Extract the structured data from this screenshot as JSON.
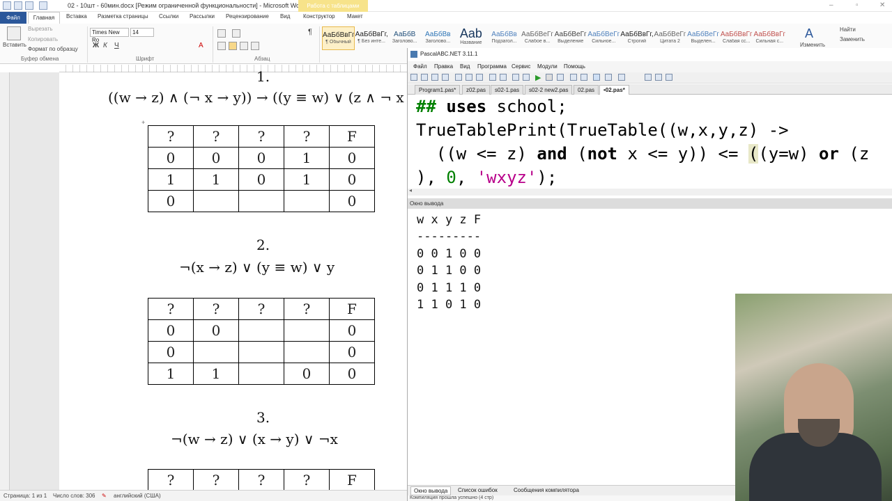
{
  "word": {
    "title": "02 - 10шт - 60мин.docx [Режим ограниченной функциональности] - Microsoft Word",
    "context_tab": "Работа с таблицами",
    "tabs": [
      "Файл",
      "Главная",
      "Вставка",
      "Разметка страницы",
      "Ссылки",
      "Рассылки",
      "Рецензирование",
      "Вид",
      "Конструктор",
      "Макет"
    ],
    "clipboard": {
      "paste": "Вставить",
      "cut": "Вырезать",
      "copy": "Копировать",
      "format": "Формат по образцу",
      "group": "Буфер обмена"
    },
    "font": {
      "name": "Times New Ro",
      "size": "14",
      "group": "Шрифт"
    },
    "paragraph_group": "Абзац",
    "styles": [
      {
        "sample": "АаБбВвГг,",
        "name": "¶ Обычный"
      },
      {
        "sample": "АаБбВвГг,",
        "name": "¶ Без инте..."
      },
      {
        "sample": "АаБбВ",
        "name": "Заголово..."
      },
      {
        "sample": "АаБбВв",
        "name": "Заголово..."
      },
      {
        "sample": "Aab",
        "name": "Название"
      },
      {
        "sample": "АаБбВв",
        "name": "Подзагол..."
      },
      {
        "sample": "АаБбВеГг",
        "name": "Слабое в..."
      },
      {
        "sample": "АаБбВеГг",
        "name": "Выделение"
      },
      {
        "sample": "АаБбВеГг",
        "name": "Сильное..."
      },
      {
        "sample": "АаБбВвГг,",
        "name": "Строгий"
      },
      {
        "sample": "АаБбВеГг",
        "name": "Цитата 2"
      },
      {
        "sample": "АаБбВеГг",
        "name": "Выделен..."
      },
      {
        "sample": "АаБбВвГг",
        "name": "Слабая сс..."
      },
      {
        "sample": "АаБбВвГг",
        "name": "Сильная с..."
      }
    ],
    "edit": {
      "change": "Изменить",
      "find": "Найти",
      "replace": "Заменить"
    },
    "doc": {
      "expr1": "((w → z) ∧ (¬ x → y)) → ((y ≡ w) ∨ (z ∧ ¬ x",
      "heading1": "1.",
      "table1": [
        [
          "?",
          "?",
          "?",
          "?",
          "F"
        ],
        [
          "0",
          "0",
          "0",
          "1",
          "0"
        ],
        [
          "1",
          "1",
          "0",
          "1",
          "0"
        ],
        [
          "0",
          "",
          "",
          "",
          "0"
        ]
      ],
      "heading2": "2.",
      "expr2": "¬(x → z) ∨ (y ≡ w) ∨ y",
      "table2": [
        [
          "?",
          "?",
          "?",
          "?",
          "F"
        ],
        [
          "0",
          "0",
          "",
          "",
          "0"
        ],
        [
          "0",
          "",
          "",
          "",
          "0"
        ],
        [
          "1",
          "1",
          "",
          "0",
          "0"
        ]
      ],
      "heading3": "3.",
      "expr3": "¬(w → z) ∨ (x → y) ∨ ¬x",
      "table3": [
        [
          "?",
          "?",
          "?",
          "?",
          "F"
        ]
      ]
    },
    "status": {
      "page": "Страница: 1 из 1",
      "words": "Число слов: 306",
      "lang": "английский (США)"
    }
  },
  "pascal": {
    "title": "PascalABC.NET 3.11.1",
    "menu": [
      "Файл",
      "Правка",
      "Вид",
      "Программа",
      "Сервис",
      "Модули",
      "Помощь"
    ],
    "tabs": [
      "Program1.pas*",
      "z02.pas",
      "s02-1.pas",
      "s02-2 new2.pas",
      "02.pas",
      "•02.pas*"
    ],
    "code": {
      "l1_hash": "##",
      "l1_kw": "uses",
      "l1_rest": " school;",
      "l2": "TrueTablePrint(TrueTable((w,x,y,z) ->",
      "l3a": "  ((w <= z) ",
      "l3_and": "and",
      "l3b": " (",
      "l3_not": "not",
      "l3c": " x <= y)) <= ",
      "l3_hl": "(",
      "l3d": "(y=w) ",
      "l3_or": "or",
      "l3e": " (z",
      "l4a": "), ",
      "l4_zero": "0",
      "l4b": ", ",
      "l4_str": "'wxyz'",
      "l4c": ");"
    },
    "output_header": "Окно вывода",
    "output": [
      "w x y z F",
      "---------",
      "0 0 1 0 0",
      "0 1 1 0 0",
      "0 1 1 1 0",
      "1 1 0 1 0"
    ],
    "bottom_tabs": [
      "Окно вывода",
      "Список ошибок",
      "Сообщения компилятора"
    ],
    "compile_status": "Компиляция прошла успешно (4 стр)"
  }
}
